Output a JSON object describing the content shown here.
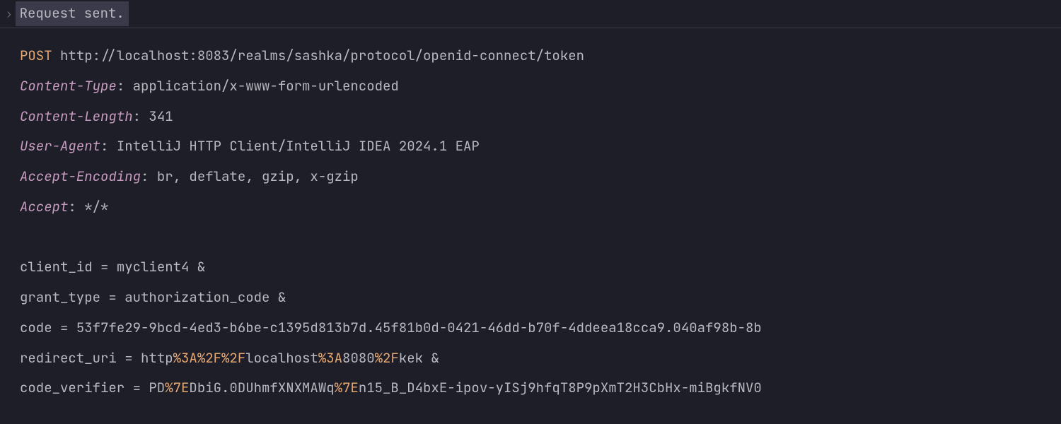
{
  "status": {
    "chevron": "›",
    "text": "Request sent."
  },
  "request": {
    "method": "POST",
    "url": "http://localhost:8083/realms/sashka/protocol/openid-connect/token"
  },
  "headers": [
    {
      "name": "Content-Type",
      "value": "application/x-www-form-urlencoded"
    },
    {
      "name": "Content-Length",
      "value": "341"
    },
    {
      "name": "User-Agent",
      "value": "IntelliJ HTTP Client/IntelliJ IDEA 2024.1 EAP"
    },
    {
      "name": "Accept-Encoding",
      "value": "br, deflate, gzip, x-gzip"
    },
    {
      "name": "Accept",
      "value": "*/*"
    }
  ],
  "body_params": [
    {
      "key": "client_id",
      "segments": [
        {
          "text": "myclient4",
          "encoded": false
        }
      ],
      "trailing_amp": true
    },
    {
      "key": "grant_type",
      "segments": [
        {
          "text": "authorization_code",
          "encoded": false
        }
      ],
      "trailing_amp": true
    },
    {
      "key": "code",
      "segments": [
        {
          "text": "53f7fe29-9bcd-4ed3-b6be-c1395d813b7d.45f81b0d-0421-46dd-b70f-4ddeea18cca9.040af98b-8b",
          "encoded": false
        }
      ],
      "trailing_amp": false
    },
    {
      "key": "redirect_uri",
      "segments": [
        {
          "text": "http",
          "encoded": false
        },
        {
          "text": "%3A%2F%2F",
          "encoded": true
        },
        {
          "text": "localhost",
          "encoded": false
        },
        {
          "text": "%3A",
          "encoded": true
        },
        {
          "text": "8080",
          "encoded": false
        },
        {
          "text": "%2F",
          "encoded": true
        },
        {
          "text": "kek",
          "encoded": false
        }
      ],
      "trailing_amp": true
    },
    {
      "key": "code_verifier",
      "segments": [
        {
          "text": "PD",
          "encoded": false
        },
        {
          "text": "%7E",
          "encoded": true
        },
        {
          "text": "DbiG.0DUhmfXNXMAWq",
          "encoded": false
        },
        {
          "text": "%7E",
          "encoded": true
        },
        {
          "text": "n15_B_D4bxE-ipov-yISj9hfqT8P9pXmT2H3CbHx-miBgkfNV0",
          "encoded": false
        }
      ],
      "trailing_amp": false
    }
  ]
}
